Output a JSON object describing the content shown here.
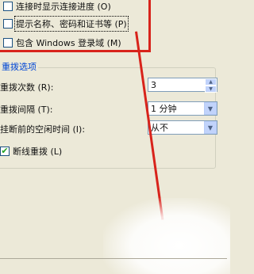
{
  "checkboxes": [
    {
      "label": "连接时显示连接进度 (O)",
      "checked": false
    },
    {
      "label": "提示名称、密码和证书等 (P)",
      "checked": false
    },
    {
      "label": "包含 Windows 登录域 (M)",
      "checked": false
    }
  ],
  "redial_group": {
    "title": "重拨选项",
    "redial_attempts_label": "重拨次数 (R):",
    "redial_attempts_value": "3",
    "redial_interval_label": "重拨间隔 (T):",
    "redial_interval_value": "1 分钟",
    "idle_time_label": "挂断前的空闲时间 (I):",
    "idle_time_value": "从不",
    "redial_if_dropped_label": "断线重拨 (L)",
    "redial_if_dropped_checked": true
  },
  "colors": {
    "highlight_red": "#d8231b",
    "group_title_blue": "#0046d5",
    "dialog_bg": "#ece9d8"
  }
}
